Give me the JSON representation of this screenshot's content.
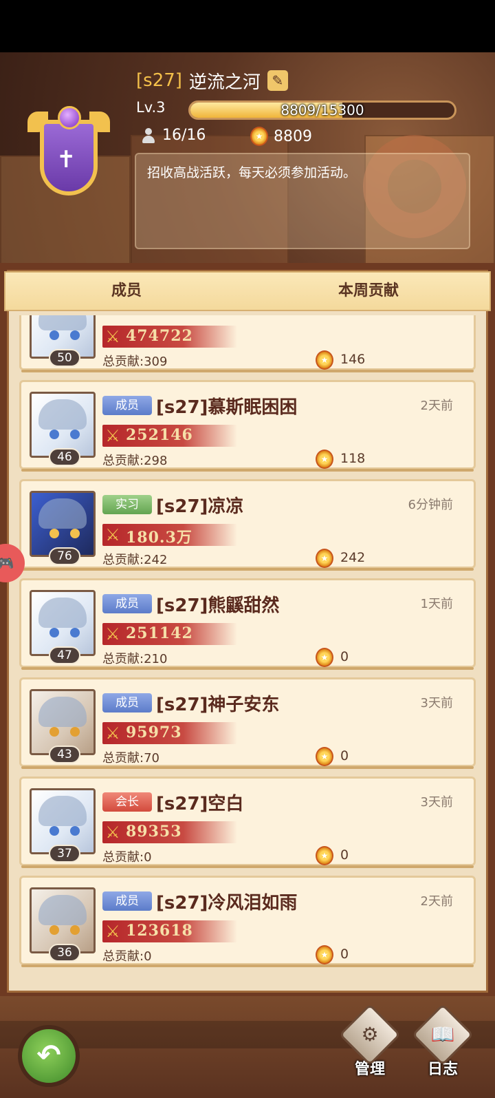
{
  "guild": {
    "tag": "[s27]",
    "name": "逆流之河",
    "level": "Lv.3",
    "xp_text": "8809/15300",
    "xp_fraction": 0.576,
    "members": "16/16",
    "contribution": "8809",
    "announcement": "招收高战活跃，每天必须参加活动。"
  },
  "tabs": [
    "成员",
    "本周贡献"
  ],
  "members": [
    {
      "avatar": "white",
      "level": "50",
      "role": "",
      "role_class": "",
      "name": "",
      "last_seen": "",
      "power": "474722",
      "total": "总贡献:309",
      "weekly": "146",
      "partial": true
    },
    {
      "avatar": "white",
      "level": "46",
      "role": "成员",
      "role_class": "member",
      "name": "[s27]慕斯眠困困",
      "last_seen": "2天前",
      "power": "252146",
      "total": "总贡献:298",
      "weekly": "118"
    },
    {
      "avatar": "dark",
      "level": "76",
      "role": "实习",
      "role_class": "intern",
      "name": "[s27]凉凉",
      "last_seen": "6分钟前",
      "power": "180.3万",
      "total": "总贡献:242",
      "weekly": "242"
    },
    {
      "avatar": "white",
      "level": "47",
      "role": "成员",
      "role_class": "member",
      "name": "[s27]熊鼷甜然",
      "last_seen": "1天前",
      "power": "251142",
      "total": "总贡献:210",
      "weekly": "0"
    },
    {
      "avatar": "silver",
      "level": "43",
      "role": "成员",
      "role_class": "member",
      "name": "[s27]神子安东",
      "last_seen": "3天前",
      "power": "95973",
      "total": "总贡献:70",
      "weekly": "0"
    },
    {
      "avatar": "white",
      "level": "37",
      "role": "会长",
      "role_class": "leader",
      "name": "[s27]空白",
      "last_seen": "3天前",
      "power": "89353",
      "total": "总贡献:0",
      "weekly": "0"
    },
    {
      "avatar": "silver",
      "level": "36",
      "role": "成员",
      "role_class": "member",
      "name": "[s27]冷风泪如雨",
      "last_seen": "2天前",
      "power": "123618",
      "total": "总贡献:0",
      "weekly": "0"
    }
  ],
  "footer": {
    "manage_label": "管理",
    "log_label": "日志"
  },
  "icons": {
    "edit": "edit-icon",
    "person": "person-icon",
    "medal": "medal-icon",
    "swords": "swords-icon",
    "back": "back-arrow-icon",
    "gear": "gear-icon",
    "book": "book-icon"
  }
}
